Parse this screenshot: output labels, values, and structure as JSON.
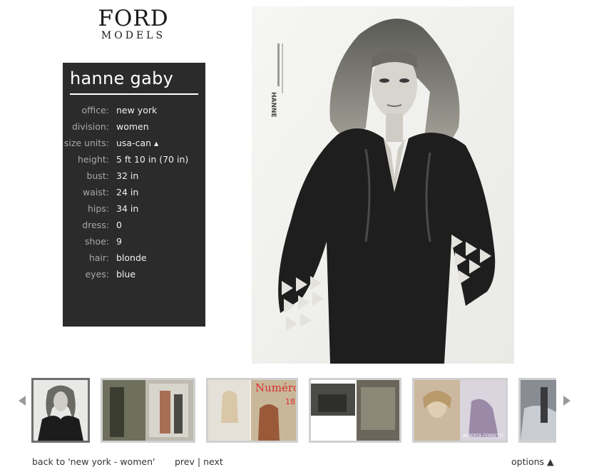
{
  "logo": {
    "line1": "FORD",
    "line2": "MODELS"
  },
  "model": {
    "name": "hanne gaby",
    "attributes": [
      {
        "label": "office:",
        "value": "new york"
      },
      {
        "label": "division:",
        "value": "women"
      },
      {
        "label": "size units:",
        "value": "usa-can ▴"
      },
      {
        "label": "height:",
        "value": "5 ft 10 in (70 in)"
      },
      {
        "label": "bust:",
        "value": "32 in"
      },
      {
        "label": "waist:",
        "value": "24 in"
      },
      {
        "label": "hips:",
        "value": "34 in"
      },
      {
        "label": "dress:",
        "value": "0"
      },
      {
        "label": "shoe:",
        "value": "9"
      },
      {
        "label": "hair:",
        "value": "blonde"
      },
      {
        "label": "eyes:",
        "value": "blue"
      }
    ]
  },
  "photo": {
    "side_text": "HANNE"
  },
  "thumbnails": {
    "magazine_title": "Numéro",
    "magazine_issue": "18",
    "brand_text": "ALBERTA FERRETTI"
  },
  "footer": {
    "back_link": "back to 'new york - women'",
    "prev": "prev",
    "separator": "|",
    "next": "next",
    "options": "options ▲"
  },
  "colors": {
    "panel_bg": "#2b2b2b",
    "label": "#a8a8a8",
    "value": "#f0f0f0",
    "selected_border": "#6e6e6e"
  }
}
